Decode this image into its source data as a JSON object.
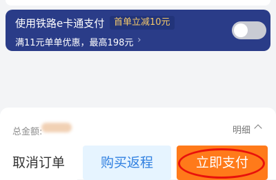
{
  "promo": {
    "title": "使用铁路e卡通支付",
    "badge": "首单立减10元",
    "desc": "满11元单单优惠，最高198元",
    "chevron": "›",
    "toggle_on": false
  },
  "footer": {
    "total_label": "总金额:",
    "details_label": "明细",
    "cancel_label": "取消订单",
    "return_label": "购买返程",
    "pay_label": "立即支付"
  },
  "colors": {
    "promo_bg": "#2a3c88",
    "badge_text": "#f4c86a",
    "return_bg": "#e6f4ff",
    "return_text": "#2f7fe0",
    "pay_bg": "#ff7a1a",
    "highlight": "#e8120c"
  }
}
